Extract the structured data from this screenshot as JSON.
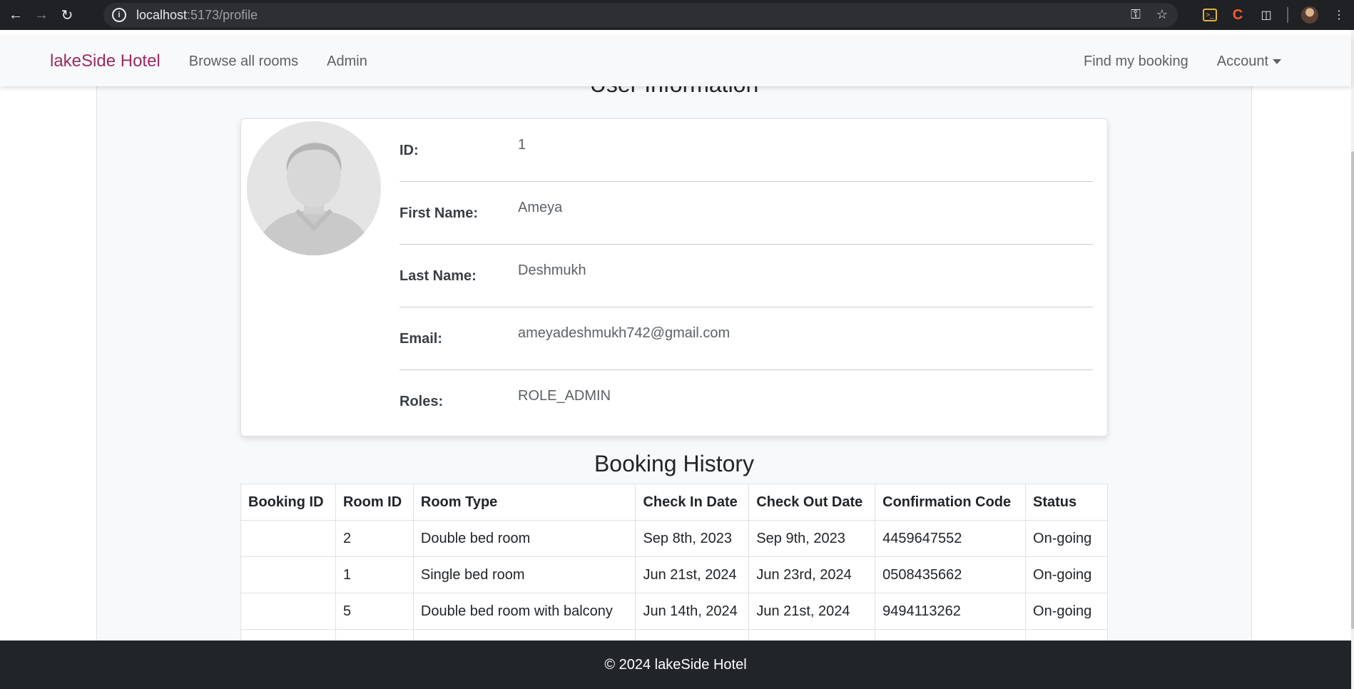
{
  "browser": {
    "url_host": "localhost",
    "url_path": ":5173/profile"
  },
  "navbar": {
    "brand": "lakeSide Hotel",
    "links": [
      "Browse all rooms",
      "Admin"
    ],
    "right_links": [
      "Find my booking",
      "Account"
    ]
  },
  "profile": {
    "section_title": "User Information",
    "fields": [
      {
        "label": "ID:",
        "value": "1"
      },
      {
        "label": "First Name:",
        "value": "Ameya"
      },
      {
        "label": "Last Name:",
        "value": "Deshmukh"
      },
      {
        "label": "Email:",
        "value": "ameyadeshmukh742@gmail.com"
      },
      {
        "label": "Roles:",
        "value": "ROLE_ADMIN"
      }
    ]
  },
  "history": {
    "title": "Booking History",
    "columns": [
      "Booking ID",
      "Room ID",
      "Room Type",
      "Check In Date",
      "Check Out Date",
      "Confirmation Code",
      "Status"
    ],
    "rows": [
      [
        "",
        "2",
        "Double bed room",
        "Sep 8th, 2023",
        "Sep 9th, 2023",
        "4459647552",
        "On-going"
      ],
      [
        "",
        "1",
        "Single bed room",
        "Jun 21st, 2024",
        "Jun 23rd, 2024",
        "0508435662",
        "On-going"
      ],
      [
        "",
        "5",
        "Double bed room with balcony",
        "Jun 14th, 2024",
        "Jun 21st, 2024",
        "9494113262",
        "On-going"
      ],
      [
        "",
        "",
        "",
        "",
        "",
        "",
        ""
      ]
    ]
  },
  "footer": {
    "text": "© 2024 lakeSide Hotel"
  },
  "colors": {
    "brand": "#9c2a63",
    "status_ongoing": "#198754",
    "footer_bg": "#212529"
  }
}
